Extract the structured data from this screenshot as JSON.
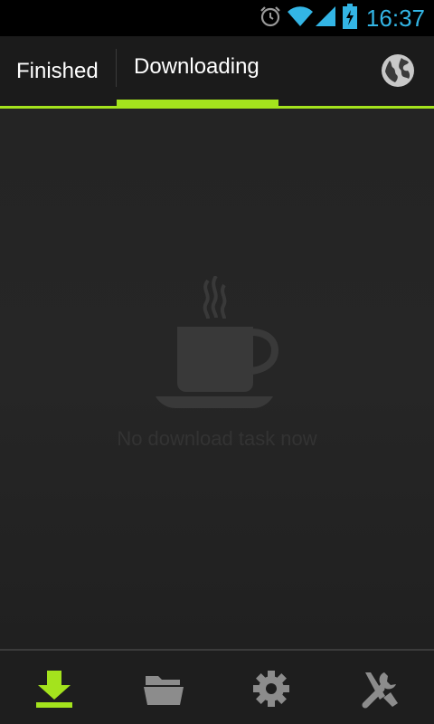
{
  "status_bar": {
    "time": "16:37",
    "icons": [
      "alarm-icon",
      "wifi-icon",
      "signal-icon",
      "battery-charging-icon"
    ],
    "accent_color": "#33b5e5"
  },
  "tabs": {
    "items": [
      {
        "label": "Finished",
        "active": false
      },
      {
        "label": "Downloading",
        "active": true
      }
    ],
    "accent_color": "#a4e31d",
    "action_icon": "globe-icon"
  },
  "main": {
    "empty_icon": "coffee-cup-icon",
    "empty_message": "No download task now"
  },
  "bottom_nav": {
    "items": [
      {
        "icon": "download-icon",
        "active": true
      },
      {
        "icon": "folder-icon",
        "active": false
      },
      {
        "icon": "gear-icon",
        "active": false
      },
      {
        "icon": "tools-icon",
        "active": false
      }
    ]
  }
}
